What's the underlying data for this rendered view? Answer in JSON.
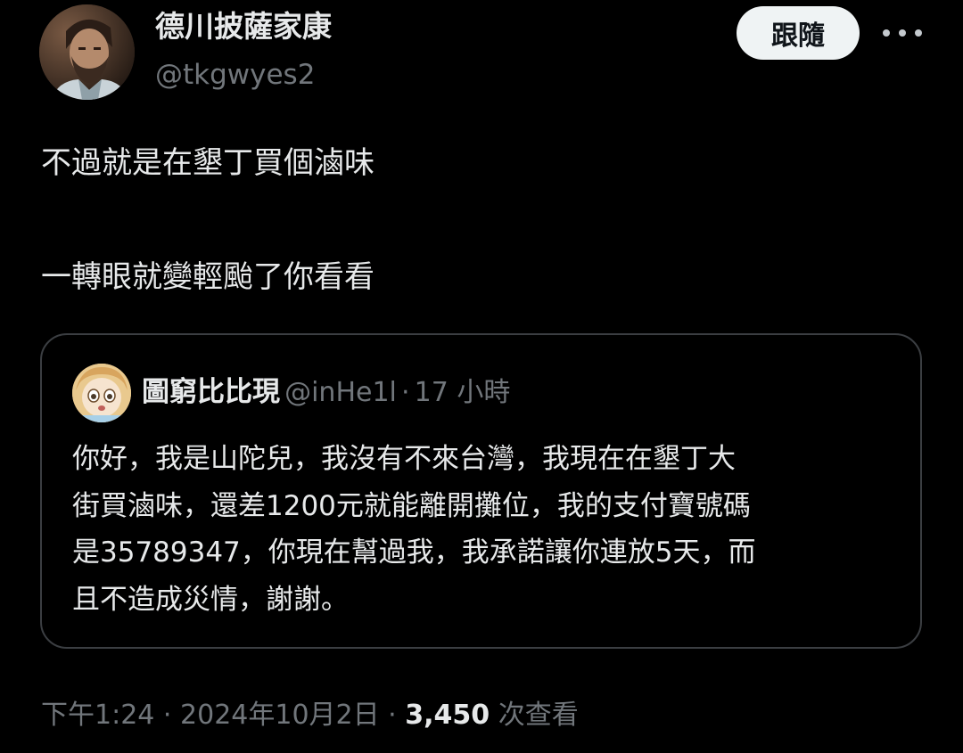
{
  "author": {
    "display_name": "德川披薩家康",
    "handle": "@tkgwyes2",
    "avatar_icon": "profile-photo-bearded-man"
  },
  "actions": {
    "follow_label": "跟隨",
    "more_icon": "more-horizontal-icon"
  },
  "tweet": {
    "lines": [
      "不過就是在墾丁買個滷味",
      "一轉眼就變輕颱了你看看"
    ]
  },
  "quote": {
    "display_name": "圖窮比比現",
    "handle": "@inHe1l",
    "dot": "·",
    "time": "17 小時",
    "avatar_icon": "anime-girl-avatar",
    "lines": [
      "你好，我是山陀兒，我沒有不來台灣，我現在在墾丁大",
      "街買滷味，還差1200元就能離開攤位，我的支付寶號碼",
      "是35789347，你現在幫過我，我承諾讓你連放5天，而",
      "且不造成災情，謝謝。"
    ]
  },
  "meta": {
    "time": "下午1:24",
    "sep1": "·",
    "date": "2024年10月2日",
    "sep2": "·",
    "views_count": "3,450",
    "views_label": "次查看"
  },
  "colors": {
    "background": "#000000",
    "text_primary": "#e7e9ea",
    "text_secondary": "#71767b",
    "border": "#3b3e42",
    "follow_button_bg": "#eff3f4"
  }
}
